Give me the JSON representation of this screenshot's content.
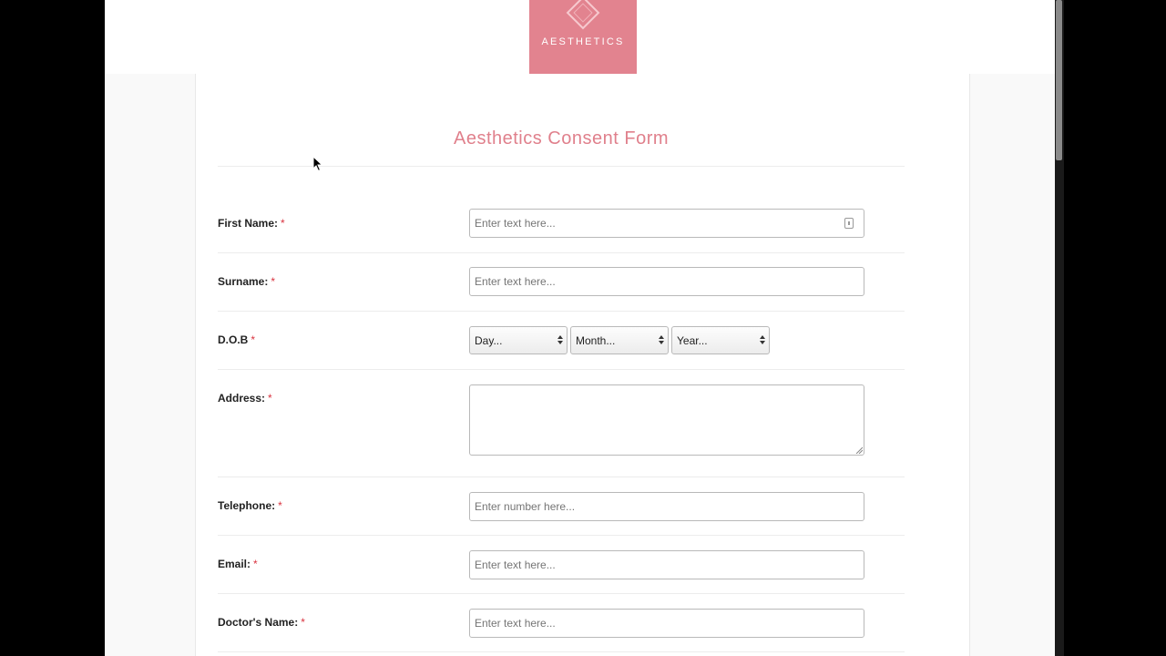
{
  "brand": {
    "logo_text": "AESTHETICS",
    "color": "#e2838f"
  },
  "form": {
    "title": "Aesthetics Consent Form",
    "required_marker": "*",
    "fields": {
      "first_name": {
        "label": "First Name:",
        "placeholder": "Enter text here..."
      },
      "surname": {
        "label": "Surname:",
        "placeholder": "Enter text here..."
      },
      "dob": {
        "label": "D.O.B",
        "day": "Day...",
        "month": "Month...",
        "year": "Year..."
      },
      "address": {
        "label": "Address:"
      },
      "telephone": {
        "label": "Telephone:",
        "placeholder": "Enter number here..."
      },
      "email": {
        "label": "Email:",
        "placeholder": "Enter text here..."
      },
      "doctor_name": {
        "label": "Doctor's Name:",
        "placeholder": "Enter text here..."
      }
    }
  }
}
